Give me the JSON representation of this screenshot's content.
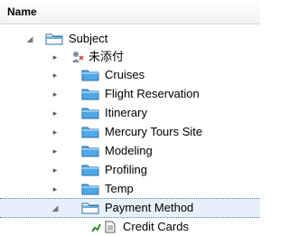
{
  "header": {
    "title": "Name"
  },
  "tree": {
    "root": {
      "label": "Subject"
    },
    "children": [
      {
        "label": "未添付"
      },
      {
        "label": "Cruises"
      },
      {
        "label": "Flight Reservation"
      },
      {
        "label": "Itinerary"
      },
      {
        "label": "Mercury Tours Site"
      },
      {
        "label": "Modeling"
      },
      {
        "label": "Profiling"
      },
      {
        "label": "Temp"
      },
      {
        "label": "Payment Method"
      }
    ],
    "grandchild": {
      "label": "Credit Cards"
    }
  },
  "colors": {
    "folder_fill": "#4fa7e6",
    "folder_edge": "#2f6fa6",
    "selection_bg": "#e6f0fb",
    "selection_border": "#5a7fb0"
  },
  "icons": {
    "collapsed_arrow": "arrow-right",
    "expanded_arrow": "arrow-down",
    "folder": "folder-icon",
    "open_folder": "open-folder-icon",
    "unattached": "unattached-icon",
    "test": "test-icon"
  }
}
